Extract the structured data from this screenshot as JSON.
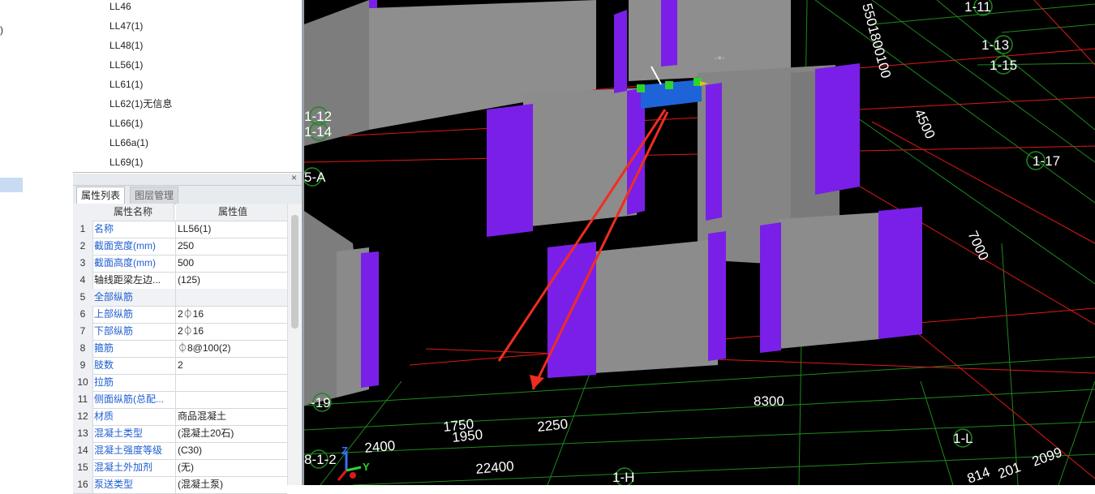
{
  "left_strip": {
    "fragment": ")"
  },
  "tree": {
    "items": [
      "LL46",
      "LL47(1)",
      "LL48(1)",
      "LL56(1)",
      "LL61(1)",
      "LL62(1)无信息",
      "LL66(1)",
      "LL66a(1)",
      "LL69(1)"
    ]
  },
  "panel": {
    "close_glyph": "×",
    "tabs": {
      "properties": "属性列表",
      "layers": "图层管理"
    }
  },
  "props": {
    "header": {
      "name": "属性名称",
      "value": "属性值"
    },
    "rows": [
      {
        "num": "1",
        "name": "名称",
        "value": "LL56(1)",
        "blue": true
      },
      {
        "num": "2",
        "name": "截面宽度(mm)",
        "value": "250",
        "blue": true
      },
      {
        "num": "3",
        "name": "截面高度(mm)",
        "value": "500",
        "blue": true
      },
      {
        "num": "4",
        "name": "轴线距梁左边...",
        "value": "(125)",
        "blue": false
      },
      {
        "num": "5",
        "name": "全部纵筋",
        "value": "",
        "blue": true
      },
      {
        "num": "6",
        "name": "上部纵筋",
        "value": "2⏀16",
        "blue": true
      },
      {
        "num": "7",
        "name": "下部纵筋",
        "value": "2⏀16",
        "blue": true
      },
      {
        "num": "8",
        "name": "箍筋",
        "value": "⏀8@100(2)",
        "blue": true
      },
      {
        "num": "9",
        "name": "肢数",
        "value": "2",
        "blue": true
      },
      {
        "num": "10",
        "name": "拉筋",
        "value": "",
        "blue": true
      },
      {
        "num": "11",
        "name": "侧面纵筋(总配...",
        "value": "",
        "blue": true
      },
      {
        "num": "12",
        "name": "材质",
        "value": "商品混凝土",
        "blue": true
      },
      {
        "num": "13",
        "name": "混凝土类型",
        "value": "(混凝土20石)",
        "blue": true
      },
      {
        "num": "14",
        "name": "混凝土强度等级",
        "value": "(C30)",
        "blue": true
      },
      {
        "num": "15",
        "name": "混凝土外加剂",
        "value": "(无)",
        "blue": true
      },
      {
        "num": "16",
        "name": "泵送类型",
        "value": "(混凝土泵)",
        "blue": true
      }
    ]
  },
  "viewport": {
    "axis_labels": [
      "1-11",
      "1-13",
      "1-15",
      "1-17",
      "1-12",
      "1-14",
      "5-A",
      "-19",
      "8-1-2",
      "1-H",
      "1-L"
    ],
    "dim_labels": [
      "5501800100",
      "4500",
      "7000",
      "8300",
      "1750",
      "1950",
      "2250",
      "2400",
      "22400",
      "814",
      "201",
      "2099"
    ],
    "triad": {
      "z": "Z",
      "y": "Y"
    },
    "colors": {
      "wall_gray": "#8c8c8c",
      "column_purple": "#7a1fe8",
      "selected_beam": "#1f63d8",
      "grid_green": "#1d8a1d",
      "axis_red": "#e01818",
      "annotation_arrow": "#ef2d20"
    }
  }
}
